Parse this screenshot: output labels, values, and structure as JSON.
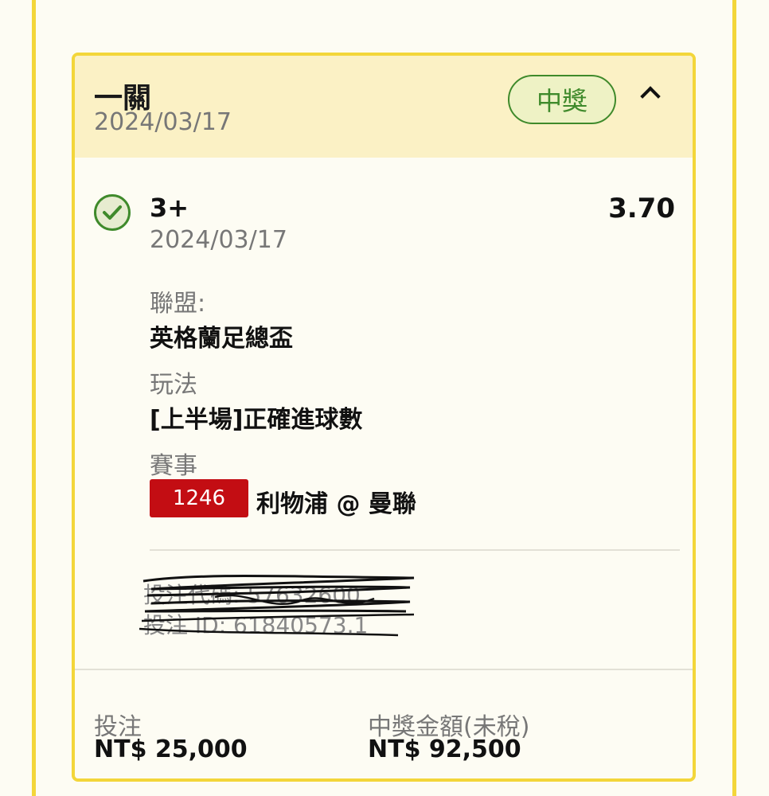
{
  "card": {
    "bet_type": "一關",
    "date": "2024/03/17",
    "status_badge": "中獎"
  },
  "selection": {
    "name": "3+",
    "date": "2024/03/17",
    "odds": "3.70",
    "league_label": "聯盟:",
    "league_value": "英格蘭足總盃",
    "play_label": "玩法",
    "play_value": "[上半場]正確進球數",
    "match_label": "賽事",
    "match_code": "1246",
    "match_name": "利物浦 @ 曼聯"
  },
  "ticket": {
    "line1": "投注代碼: 57632600",
    "line2": "投注 ID: 61840573.1"
  },
  "footer": {
    "stake_label": "投注",
    "stake_value": "NT$ 25,000",
    "payout_label": "中獎金額(未稅)",
    "payout_value": "NT$ 92,500"
  },
  "colors": {
    "accent_border": "#f3d63a",
    "header_bg": "#fbf1c5",
    "win_green": "#3f8a2b",
    "match_code_red": "#c30d13"
  },
  "icons": {
    "status": "check-circle-icon",
    "expand": "chevron-up-icon"
  }
}
